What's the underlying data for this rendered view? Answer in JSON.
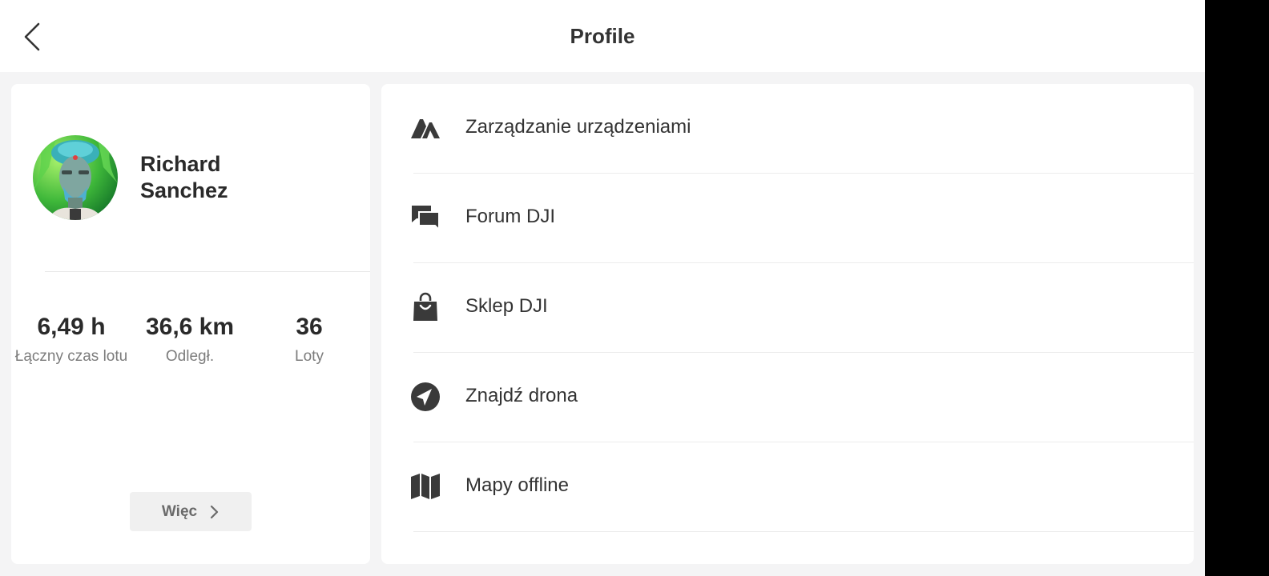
{
  "header": {
    "title": "Profile"
  },
  "user": {
    "first_name": "Richard",
    "last_name": "Sanchez"
  },
  "stats": [
    {
      "value": "6,49 h",
      "label": "Łączny czas lotu"
    },
    {
      "value": "36,6 km",
      "label": "Odległ."
    },
    {
      "value": "36",
      "label": "Loty"
    }
  ],
  "more_button": {
    "label": "Więc"
  },
  "menu": [
    {
      "label": "Zarządzanie urządzeniami",
      "icon": "device-management-icon"
    },
    {
      "label": "Forum DJI",
      "icon": "forum-chat-icon"
    },
    {
      "label": "Sklep DJI",
      "icon": "shopping-bag-icon"
    },
    {
      "label": "Znajdź drona",
      "icon": "compass-navigation-icon"
    },
    {
      "label": "Mapy offline",
      "icon": "map-icon"
    }
  ],
  "colors": {
    "background": "#f4f4f5",
    "card": "#ffffff",
    "text": "#333333",
    "muted": "#7c7c7c"
  }
}
